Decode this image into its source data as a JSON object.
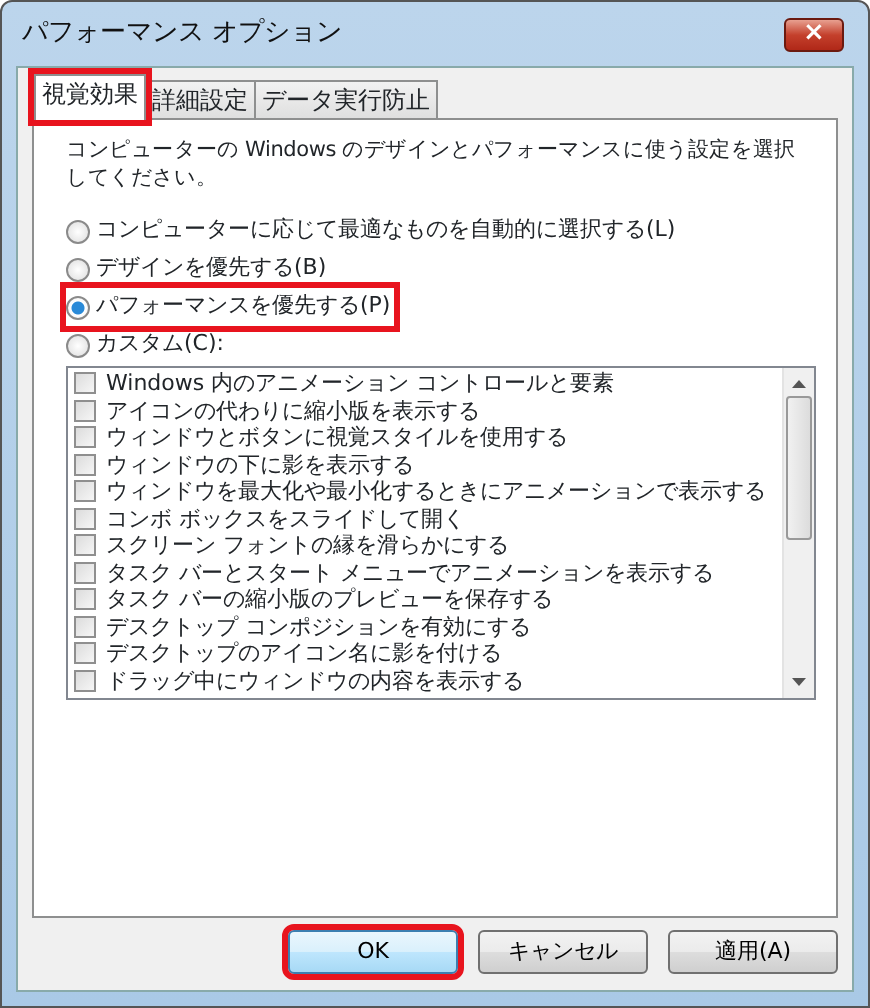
{
  "window": {
    "title": "パフォーマンス オプション",
    "close": "×"
  },
  "tabs": [
    {
      "label": "視覚効果",
      "selected": true,
      "highlighted": true
    },
    {
      "label": "詳細設定",
      "selected": false,
      "highlighted": false
    },
    {
      "label": "データ実行防止",
      "selected": false,
      "highlighted": false
    }
  ],
  "description": "コンピューターの Windows のデザインとパフォーマンスに使う設定を選択してください。",
  "options": [
    {
      "label": "コンピューターに応じて最適なものを自動的に選択する(L)",
      "selected": false,
      "highlighted": false
    },
    {
      "label": "デザインを優先する(B)",
      "selected": false,
      "highlighted": false
    },
    {
      "label": "パフォーマンスを優先する(P)",
      "selected": true,
      "highlighted": true
    },
    {
      "label": "カスタム(C):",
      "selected": false,
      "highlighted": false
    }
  ],
  "effects": [
    {
      "label": "Windows 内のアニメーション コントロールと要素",
      "checked": false
    },
    {
      "label": "アイコンの代わりに縮小版を表示する",
      "checked": false
    },
    {
      "label": "ウィンドウとボタンに視覚スタイルを使用する",
      "checked": false
    },
    {
      "label": "ウィンドウの下に影を表示する",
      "checked": false
    },
    {
      "label": "ウィンドウを最大化や最小化するときにアニメーションで表示する",
      "checked": false
    },
    {
      "label": "コンボ ボックスをスライドして開く",
      "checked": false
    },
    {
      "label": "スクリーン フォントの縁を滑らかにする",
      "checked": false
    },
    {
      "label": "タスク バーとスタート メニューでアニメーションを表示する",
      "checked": false
    },
    {
      "label": "タスク バーの縮小版のプレビューを保存する",
      "checked": false
    },
    {
      "label": "デスクトップ コンポジションを有効にする",
      "checked": false
    },
    {
      "label": "デスクトップのアイコン名に影を付ける",
      "checked": false
    },
    {
      "label": "ドラッグ中にウィンドウの内容を表示する",
      "checked": false
    }
  ],
  "buttons": [
    {
      "label": "OK",
      "highlighted": true,
      "default": true
    },
    {
      "label": "キャンセル",
      "highlighted": false,
      "default": false
    },
    {
      "label": "適用(A)",
      "highlighted": false,
      "default": false
    }
  ]
}
